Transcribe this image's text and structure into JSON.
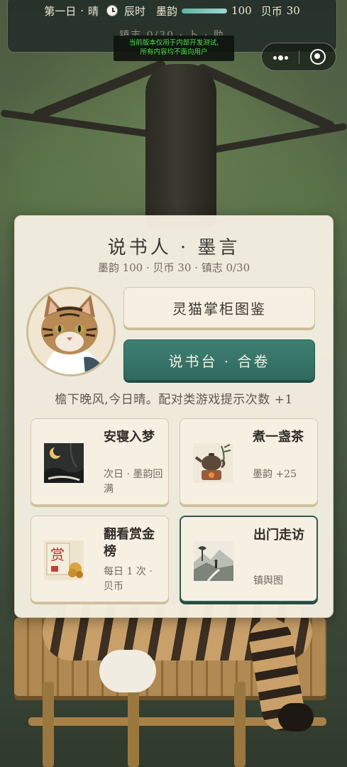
{
  "status": {
    "day": "第一日",
    "separator": "·",
    "weather": "晴",
    "time": "辰时",
    "moyun_label": "墨韵",
    "moyun_value": "100",
    "moyun_progress": 1.0,
    "beibi_label": "贝币",
    "beibi_value": "30",
    "row2_text": "镇志 0/30 · 卜 · 助"
  },
  "dev_notice": {
    "line1": "当前版本仅用于内部开发测试,",
    "line2": "所有内容均不面向用户"
  },
  "capsule": {
    "more_icon": "more-dots-icon",
    "close_icon": "target-close-icon"
  },
  "panel": {
    "title": "说书人 · 墨言",
    "subtitle": "墨韵 100 · 贝币 30 · 镇志 0/30",
    "atlas_button": "灵猫掌柜图鉴",
    "close_button": "说书台 · 合卷",
    "weather_tip": "檐下晚风,今日晴。配对类游戏提示次数 +1"
  },
  "cards": [
    {
      "title": "安寝入梦",
      "desc": "次日 · 墨韵回满",
      "icon": "moon-night-icon"
    },
    {
      "title": "煮一盏茶",
      "desc": "墨韵 +25",
      "icon": "teapot-icon"
    },
    {
      "title": "翻看赏金榜",
      "desc": "每日 1 次 · 贝币",
      "icon": "reward-scroll-icon"
    },
    {
      "title": "出门走访",
      "desc": "镇舆图",
      "icon": "landscape-map-icon"
    }
  ],
  "colors": {
    "accent": "#2f6a5e",
    "panel_bg": "#f5efe2",
    "card_border": "#d7c9a6",
    "active_border": "#2f5a52"
  }
}
